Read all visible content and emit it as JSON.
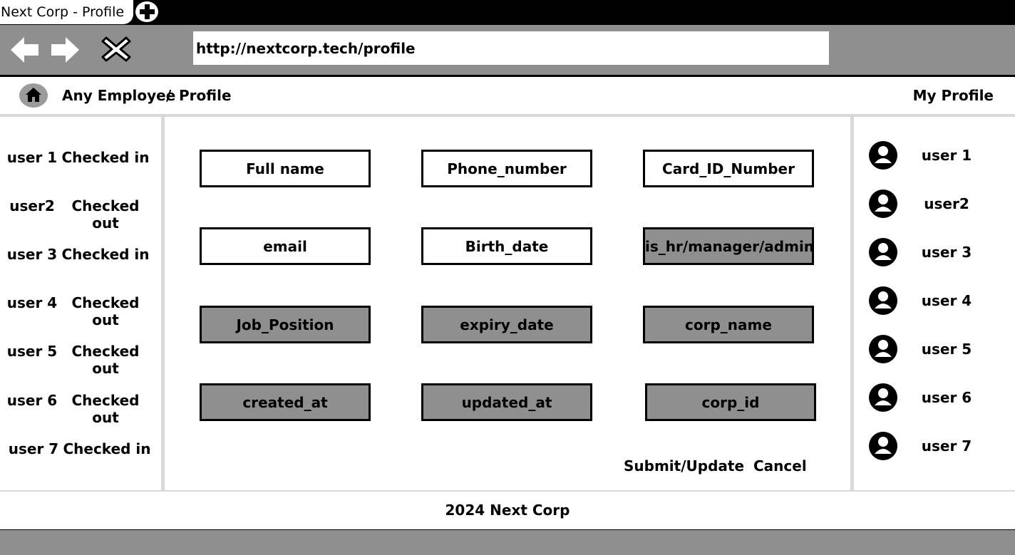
{
  "browser": {
    "tab_title": "Next Corp - Profile",
    "url": "http://nextcorp.tech/profile",
    "icons": {
      "new_tab": "plus-icon",
      "back": "arrow-left-icon",
      "forward": "arrow-right-icon",
      "stop": "close-icon"
    }
  },
  "breadcrumb": {
    "home_icon": "home-icon",
    "items": [
      "Any Employee",
      "Profile"
    ],
    "separator": "/"
  },
  "header": {
    "my_profile": "My Profile"
  },
  "left_sidebar": {
    "rows": [
      {
        "user": "user 1",
        "status": "Checked in"
      },
      {
        "user": "user2",
        "status": "Checked out"
      },
      {
        "user": "user 3",
        "status": "Checked in"
      },
      {
        "user": "user 4",
        "status": "Checked out"
      },
      {
        "user": "user 5",
        "status": "Checked out"
      },
      {
        "user": "user 6",
        "status": "Checked out"
      },
      {
        "user": "user 7",
        "status": "Checked in"
      }
    ]
  },
  "form": {
    "fields": [
      {
        "label": "Full name",
        "readonly": false
      },
      {
        "label": "Phone_number",
        "readonly": false
      },
      {
        "label": "Card_ID_Number",
        "readonly": false
      },
      {
        "label": "email",
        "readonly": false
      },
      {
        "label": "Birth_date",
        "readonly": false
      },
      {
        "label": "is_hr/manager/admin",
        "readonly": true
      },
      {
        "label": "Job_Position",
        "readonly": true
      },
      {
        "label": "expiry_date",
        "readonly": true
      },
      {
        "label": "corp_name",
        "readonly": true
      },
      {
        "label": "created_at",
        "readonly": true
      },
      {
        "label": "updated_at",
        "readonly": true
      },
      {
        "label": "corp_id",
        "readonly": true
      }
    ],
    "submit_label": "Submit/Update",
    "cancel_label": "Cancel"
  },
  "right_sidebar": {
    "avatar_icon": "user-avatar-icon",
    "users": [
      "user 1",
      "user2",
      "user 3",
      "user 4",
      "user 5",
      "user 6",
      "user 7"
    ]
  },
  "footer": {
    "text": "2024 Next Corp"
  },
  "colors": {
    "chrome_gray": "#8f8f8f",
    "divider": "#d9d9d9",
    "readonly_fill": "#8f8f8f"
  }
}
